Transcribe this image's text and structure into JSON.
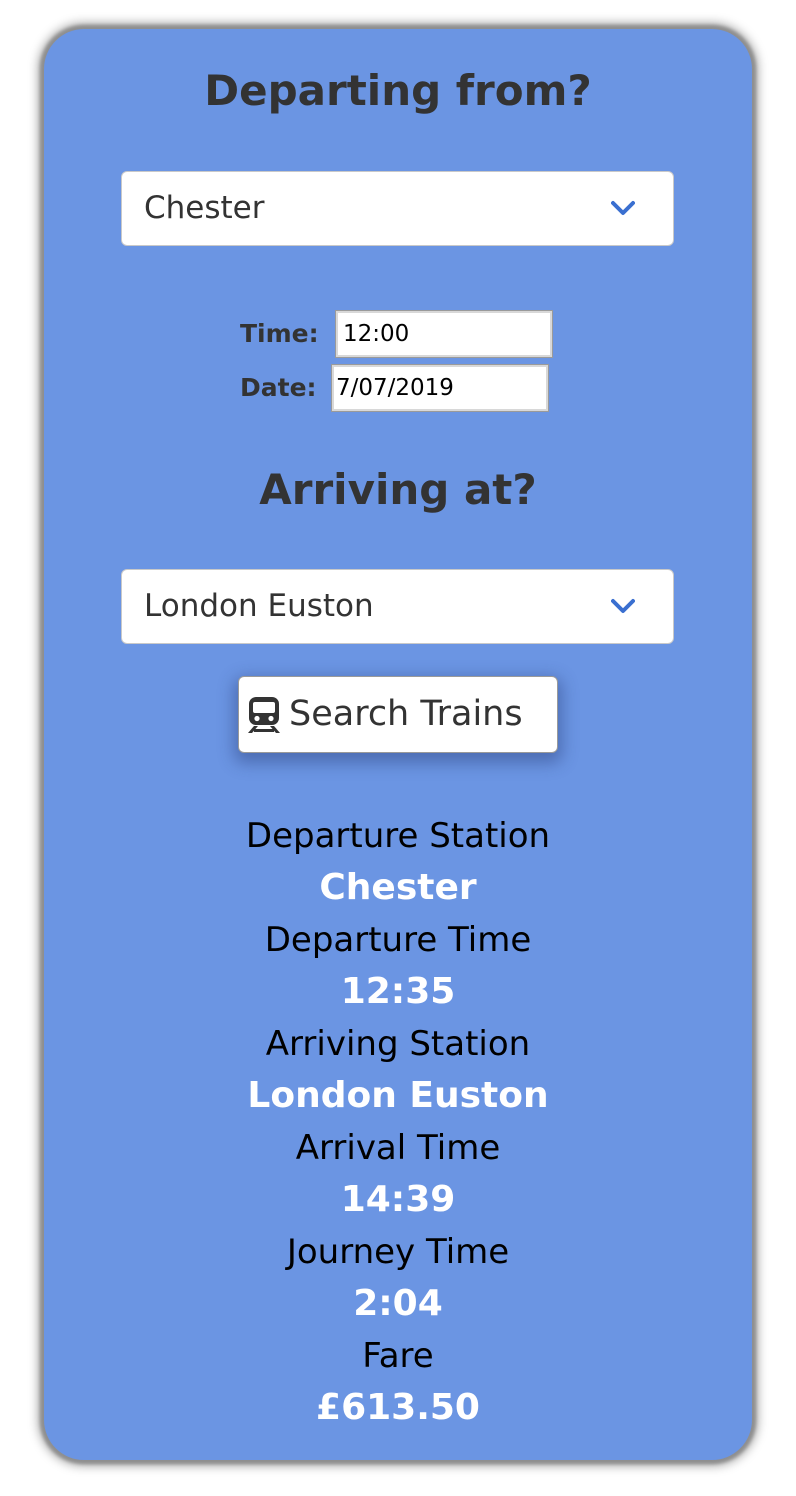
{
  "form": {
    "departing_heading": "Departing from?",
    "departure_station": "Chester",
    "time_label": "Time:",
    "time_value": "12:00",
    "date_label": "Date:",
    "date_value": "7/07/2019",
    "arriving_heading": "Arriving at?",
    "arrival_station": "London Euston",
    "search_button_label": "Search Trains",
    "search_button_icon": "train-icon"
  },
  "results": {
    "departure_station_label": "Departure Station",
    "departure_station_value": "Chester",
    "departure_time_label": "Departure Time",
    "departure_time_value": "12:35",
    "arriving_station_label": "Arriving Station",
    "arriving_station_value": "London Euston",
    "arrival_time_label": "Arrival Time",
    "arrival_time_value": "14:39",
    "journey_time_label": "Journey Time",
    "journey_time_value": "2:04",
    "fare_label": "Fare",
    "fare_value": "£613.50"
  },
  "colors": {
    "card_background": "#6b95e3",
    "heading_text": "#333333",
    "result_value_text": "#ffffff",
    "chevron": "#3a6fd0"
  }
}
